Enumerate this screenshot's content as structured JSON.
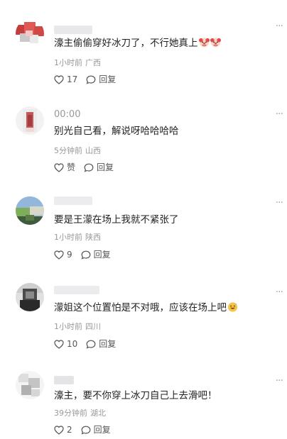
{
  "comments": [
    {
      "username": "",
      "text": "濠主偷偷穿好冰刀了，不行她真上",
      "emojis": [
        "clown-face-icon",
        "clown-face-icon"
      ],
      "time": "1小时前",
      "location": "广西",
      "like_label": "17",
      "reply_label": "回复",
      "avatar_colors": [
        "#d8504a",
        "#ffffff",
        "#c7c7c7"
      ]
    },
    {
      "username": "00:00",
      "text": "别光自己看，解说呀哈哈哈哈",
      "emojis": [],
      "time": "5分钟前",
      "location": "山西",
      "like_label": "赞",
      "reply_label": "回复",
      "avatar_colors": [
        "#e8e8e8",
        "#b94a4a",
        "#f0d5d5"
      ]
    },
    {
      "username": "",
      "text": "要是王濛在场上我就不紧张了",
      "emojis": [],
      "time": "1小时前",
      "location": "陕西",
      "like_label": "9",
      "reply_label": "回复",
      "avatar_colors": [
        "#8fb4d9",
        "#6e9a4e",
        "#3d5a3a"
      ]
    },
    {
      "username": "",
      "text": "濛姐这个位置怕是不对哦，应该在场上吧",
      "emojis": [
        "grinning-sweat-icon"
      ],
      "time": "1小时前",
      "location": "四川",
      "like_label": "10",
      "reply_label": "回复",
      "avatar_colors": [
        "#d9d9d9",
        "#5a5a5a",
        "#2a2a2a"
      ]
    },
    {
      "username": "",
      "text": "濠主，要不你穿上冰刀自己上去滑吧！",
      "emojis": [],
      "time": "39分钟前",
      "location": "湖北",
      "like_label": "2",
      "reply_label": "回复",
      "avatar_colors": [
        "#f2f2f2",
        "#bdbdbd",
        "#9a9a9a"
      ]
    }
  ],
  "more_icon": "more-dots-icon",
  "like_icon": "heart-outline-icon",
  "reply_icon": "speech-bubble-icon"
}
